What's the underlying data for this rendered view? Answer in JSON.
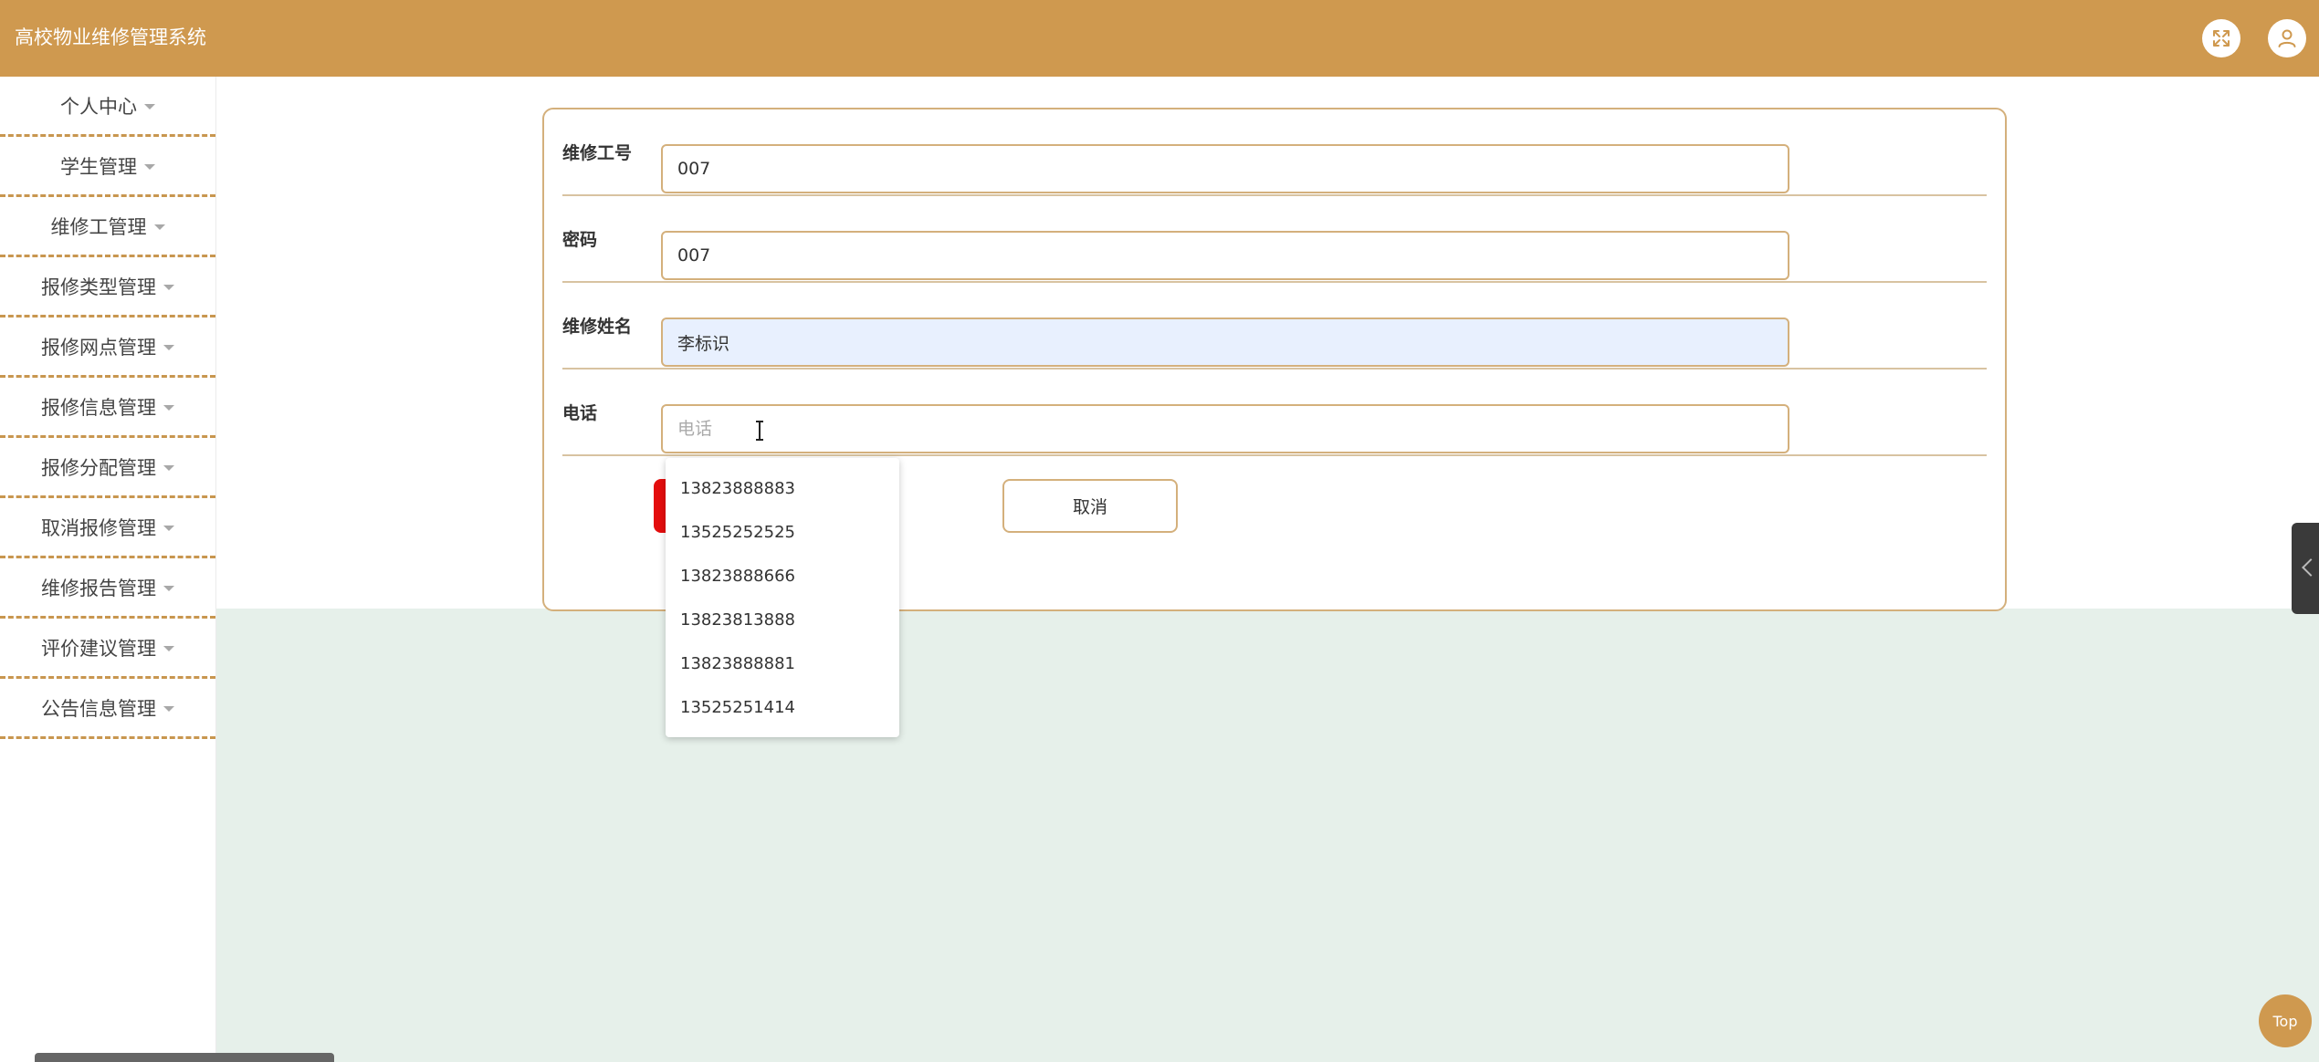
{
  "header": {
    "title": "高校物业维修管理系统",
    "icons": {
      "fullscreen": "fullscreen-icon",
      "user": "user-icon"
    }
  },
  "sidebar": {
    "items": [
      {
        "label": "个人中心"
      },
      {
        "label": "学生管理"
      },
      {
        "label": "维修工管理"
      },
      {
        "label": "报修类型管理"
      },
      {
        "label": "报修网点管理"
      },
      {
        "label": "报修信息管理"
      },
      {
        "label": "报修分配管理"
      },
      {
        "label": "取消报修管理"
      },
      {
        "label": "维修报告管理"
      },
      {
        "label": "评价建议管理"
      },
      {
        "label": "公告信息管理"
      }
    ]
  },
  "form": {
    "fields": [
      {
        "label": "维修工号",
        "value": "007",
        "placeholder": ""
      },
      {
        "label": "密码",
        "value": "007",
        "placeholder": ""
      },
      {
        "label": "维修姓名",
        "value": "李标识",
        "placeholder": ""
      },
      {
        "label": "电话",
        "value": "",
        "placeholder": "电话"
      }
    ],
    "cancel_label": "取消"
  },
  "autocomplete": {
    "options": [
      "13823888883",
      "13525252525",
      "13823888666",
      "13823813888",
      "13823888881",
      "13525251414"
    ]
  },
  "floating": {
    "top_label": "Top"
  },
  "colors": {
    "brand": "#cf994f",
    "accent_border": "#d4b07c",
    "danger": "#e40d0d",
    "content_bg": "#e6f0ea"
  }
}
